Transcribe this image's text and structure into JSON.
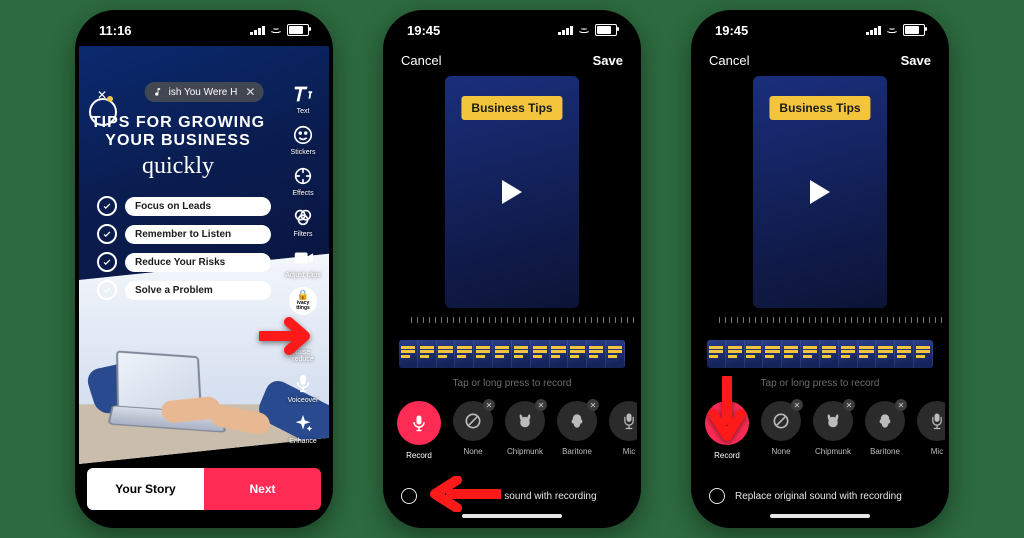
{
  "screens": {
    "s1": {
      "time": "11:16",
      "sound_chip": "ish You Were H",
      "title_line1": "TIPS FOR GROWING",
      "title_line2": "YOUR BUSINESS",
      "title_script": "quickly",
      "tips": [
        "Focus on Leads",
        "Remember to Listen",
        "Reduce Your Risks",
        "Solve a Problem"
      ],
      "tools": {
        "text": "Text",
        "stickers": "Stickers",
        "effects": "Effects",
        "filters": "Filters",
        "adjust": "Adjust clips",
        "privacy_top": "ivacy",
        "privacy_bottom": "ttings",
        "noise": "Noise\nreduce",
        "voiceover": "Voiceover",
        "enhance": "Enhance"
      },
      "btn_story": "Your Story",
      "btn_next": "Next"
    },
    "s2": {
      "time": "19:45",
      "cancel": "Cancel",
      "save": "Save",
      "chip": "Business Tips",
      "hint": "Tap or long press to record",
      "opts": {
        "record": "Record",
        "none": "None",
        "chipmunk": "Chipmunk",
        "baritone": "Baritone",
        "mic": "Mic"
      },
      "replace_text_partial": "al sound with recording"
    },
    "s3": {
      "time": "19:45",
      "cancel": "Cancel",
      "save": "Save",
      "chip": "Business Tips",
      "hint": "Tap or long press to record",
      "opts": {
        "record": "Record",
        "none": "None",
        "chipmunk": "Chipmunk",
        "baritone": "Baritone",
        "mic": "Mic"
      },
      "replace_text": "Replace original sound with recording"
    }
  }
}
